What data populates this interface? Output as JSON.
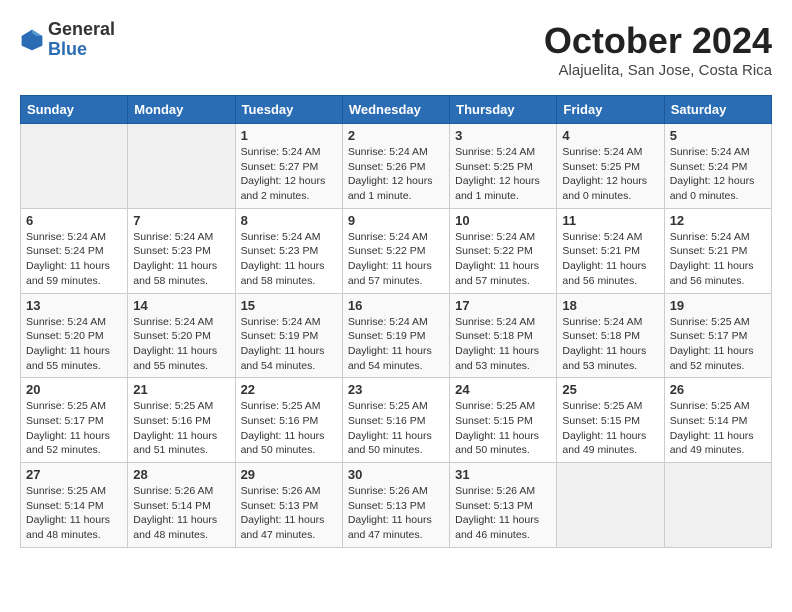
{
  "header": {
    "logo_general": "General",
    "logo_blue": "Blue",
    "month_title": "October 2024",
    "subtitle": "Alajuelita, San Jose, Costa Rica"
  },
  "days_of_week": [
    "Sunday",
    "Monday",
    "Tuesday",
    "Wednesday",
    "Thursday",
    "Friday",
    "Saturday"
  ],
  "weeks": [
    [
      {
        "day": "",
        "info": ""
      },
      {
        "day": "",
        "info": ""
      },
      {
        "day": "1",
        "info": "Sunrise: 5:24 AM\nSunset: 5:27 PM\nDaylight: 12 hours and 2 minutes."
      },
      {
        "day": "2",
        "info": "Sunrise: 5:24 AM\nSunset: 5:26 PM\nDaylight: 12 hours and 1 minute."
      },
      {
        "day": "3",
        "info": "Sunrise: 5:24 AM\nSunset: 5:25 PM\nDaylight: 12 hours and 1 minute."
      },
      {
        "day": "4",
        "info": "Sunrise: 5:24 AM\nSunset: 5:25 PM\nDaylight: 12 hours and 0 minutes."
      },
      {
        "day": "5",
        "info": "Sunrise: 5:24 AM\nSunset: 5:24 PM\nDaylight: 12 hours and 0 minutes."
      }
    ],
    [
      {
        "day": "6",
        "info": "Sunrise: 5:24 AM\nSunset: 5:24 PM\nDaylight: 11 hours and 59 minutes."
      },
      {
        "day": "7",
        "info": "Sunrise: 5:24 AM\nSunset: 5:23 PM\nDaylight: 11 hours and 58 minutes."
      },
      {
        "day": "8",
        "info": "Sunrise: 5:24 AM\nSunset: 5:23 PM\nDaylight: 11 hours and 58 minutes."
      },
      {
        "day": "9",
        "info": "Sunrise: 5:24 AM\nSunset: 5:22 PM\nDaylight: 11 hours and 57 minutes."
      },
      {
        "day": "10",
        "info": "Sunrise: 5:24 AM\nSunset: 5:22 PM\nDaylight: 11 hours and 57 minutes."
      },
      {
        "day": "11",
        "info": "Sunrise: 5:24 AM\nSunset: 5:21 PM\nDaylight: 11 hours and 56 minutes."
      },
      {
        "day": "12",
        "info": "Sunrise: 5:24 AM\nSunset: 5:21 PM\nDaylight: 11 hours and 56 minutes."
      }
    ],
    [
      {
        "day": "13",
        "info": "Sunrise: 5:24 AM\nSunset: 5:20 PM\nDaylight: 11 hours and 55 minutes."
      },
      {
        "day": "14",
        "info": "Sunrise: 5:24 AM\nSunset: 5:20 PM\nDaylight: 11 hours and 55 minutes."
      },
      {
        "day": "15",
        "info": "Sunrise: 5:24 AM\nSunset: 5:19 PM\nDaylight: 11 hours and 54 minutes."
      },
      {
        "day": "16",
        "info": "Sunrise: 5:24 AM\nSunset: 5:19 PM\nDaylight: 11 hours and 54 minutes."
      },
      {
        "day": "17",
        "info": "Sunrise: 5:24 AM\nSunset: 5:18 PM\nDaylight: 11 hours and 53 minutes."
      },
      {
        "day": "18",
        "info": "Sunrise: 5:24 AM\nSunset: 5:18 PM\nDaylight: 11 hours and 53 minutes."
      },
      {
        "day": "19",
        "info": "Sunrise: 5:25 AM\nSunset: 5:17 PM\nDaylight: 11 hours and 52 minutes."
      }
    ],
    [
      {
        "day": "20",
        "info": "Sunrise: 5:25 AM\nSunset: 5:17 PM\nDaylight: 11 hours and 52 minutes."
      },
      {
        "day": "21",
        "info": "Sunrise: 5:25 AM\nSunset: 5:16 PM\nDaylight: 11 hours and 51 minutes."
      },
      {
        "day": "22",
        "info": "Sunrise: 5:25 AM\nSunset: 5:16 PM\nDaylight: 11 hours and 50 minutes."
      },
      {
        "day": "23",
        "info": "Sunrise: 5:25 AM\nSunset: 5:16 PM\nDaylight: 11 hours and 50 minutes."
      },
      {
        "day": "24",
        "info": "Sunrise: 5:25 AM\nSunset: 5:15 PM\nDaylight: 11 hours and 50 minutes."
      },
      {
        "day": "25",
        "info": "Sunrise: 5:25 AM\nSunset: 5:15 PM\nDaylight: 11 hours and 49 minutes."
      },
      {
        "day": "26",
        "info": "Sunrise: 5:25 AM\nSunset: 5:14 PM\nDaylight: 11 hours and 49 minutes."
      }
    ],
    [
      {
        "day": "27",
        "info": "Sunrise: 5:25 AM\nSunset: 5:14 PM\nDaylight: 11 hours and 48 minutes."
      },
      {
        "day": "28",
        "info": "Sunrise: 5:26 AM\nSunset: 5:14 PM\nDaylight: 11 hours and 48 minutes."
      },
      {
        "day": "29",
        "info": "Sunrise: 5:26 AM\nSunset: 5:13 PM\nDaylight: 11 hours and 47 minutes."
      },
      {
        "day": "30",
        "info": "Sunrise: 5:26 AM\nSunset: 5:13 PM\nDaylight: 11 hours and 47 minutes."
      },
      {
        "day": "31",
        "info": "Sunrise: 5:26 AM\nSunset: 5:13 PM\nDaylight: 11 hours and 46 minutes."
      },
      {
        "day": "",
        "info": ""
      },
      {
        "day": "",
        "info": ""
      }
    ]
  ]
}
